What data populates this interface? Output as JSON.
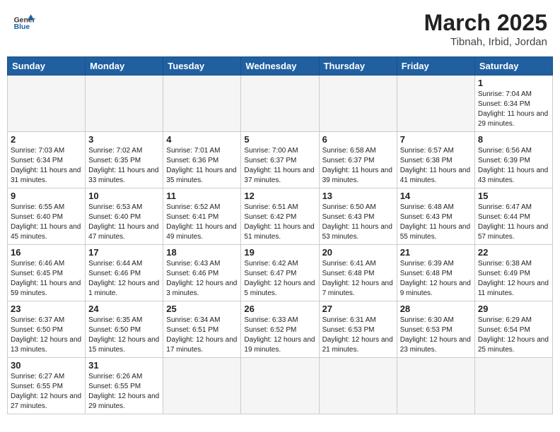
{
  "header": {
    "logo_general": "General",
    "logo_blue": "Blue",
    "month_title": "March 2025",
    "location": "Tibnah, Irbid, Jordan"
  },
  "days_of_week": [
    "Sunday",
    "Monday",
    "Tuesday",
    "Wednesday",
    "Thursday",
    "Friday",
    "Saturday"
  ],
  "weeks": [
    [
      {
        "day": "",
        "info": ""
      },
      {
        "day": "",
        "info": ""
      },
      {
        "day": "",
        "info": ""
      },
      {
        "day": "",
        "info": ""
      },
      {
        "day": "",
        "info": ""
      },
      {
        "day": "",
        "info": ""
      },
      {
        "day": "1",
        "info": "Sunrise: 7:04 AM\nSunset: 6:34 PM\nDaylight: 11 hours and 29 minutes."
      }
    ],
    [
      {
        "day": "2",
        "info": "Sunrise: 7:03 AM\nSunset: 6:34 PM\nDaylight: 11 hours and 31 minutes."
      },
      {
        "day": "3",
        "info": "Sunrise: 7:02 AM\nSunset: 6:35 PM\nDaylight: 11 hours and 33 minutes."
      },
      {
        "day": "4",
        "info": "Sunrise: 7:01 AM\nSunset: 6:36 PM\nDaylight: 11 hours and 35 minutes."
      },
      {
        "day": "5",
        "info": "Sunrise: 7:00 AM\nSunset: 6:37 PM\nDaylight: 11 hours and 37 minutes."
      },
      {
        "day": "6",
        "info": "Sunrise: 6:58 AM\nSunset: 6:37 PM\nDaylight: 11 hours and 39 minutes."
      },
      {
        "day": "7",
        "info": "Sunrise: 6:57 AM\nSunset: 6:38 PM\nDaylight: 11 hours and 41 minutes."
      },
      {
        "day": "8",
        "info": "Sunrise: 6:56 AM\nSunset: 6:39 PM\nDaylight: 11 hours and 43 minutes."
      }
    ],
    [
      {
        "day": "9",
        "info": "Sunrise: 6:55 AM\nSunset: 6:40 PM\nDaylight: 11 hours and 45 minutes."
      },
      {
        "day": "10",
        "info": "Sunrise: 6:53 AM\nSunset: 6:40 PM\nDaylight: 11 hours and 47 minutes."
      },
      {
        "day": "11",
        "info": "Sunrise: 6:52 AM\nSunset: 6:41 PM\nDaylight: 11 hours and 49 minutes."
      },
      {
        "day": "12",
        "info": "Sunrise: 6:51 AM\nSunset: 6:42 PM\nDaylight: 11 hours and 51 minutes."
      },
      {
        "day": "13",
        "info": "Sunrise: 6:50 AM\nSunset: 6:43 PM\nDaylight: 11 hours and 53 minutes."
      },
      {
        "day": "14",
        "info": "Sunrise: 6:48 AM\nSunset: 6:43 PM\nDaylight: 11 hours and 55 minutes."
      },
      {
        "day": "15",
        "info": "Sunrise: 6:47 AM\nSunset: 6:44 PM\nDaylight: 11 hours and 57 minutes."
      }
    ],
    [
      {
        "day": "16",
        "info": "Sunrise: 6:46 AM\nSunset: 6:45 PM\nDaylight: 11 hours and 59 minutes."
      },
      {
        "day": "17",
        "info": "Sunrise: 6:44 AM\nSunset: 6:46 PM\nDaylight: 12 hours and 1 minute."
      },
      {
        "day": "18",
        "info": "Sunrise: 6:43 AM\nSunset: 6:46 PM\nDaylight: 12 hours and 3 minutes."
      },
      {
        "day": "19",
        "info": "Sunrise: 6:42 AM\nSunset: 6:47 PM\nDaylight: 12 hours and 5 minutes."
      },
      {
        "day": "20",
        "info": "Sunrise: 6:41 AM\nSunset: 6:48 PM\nDaylight: 12 hours and 7 minutes."
      },
      {
        "day": "21",
        "info": "Sunrise: 6:39 AM\nSunset: 6:48 PM\nDaylight: 12 hours and 9 minutes."
      },
      {
        "day": "22",
        "info": "Sunrise: 6:38 AM\nSunset: 6:49 PM\nDaylight: 12 hours and 11 minutes."
      }
    ],
    [
      {
        "day": "23",
        "info": "Sunrise: 6:37 AM\nSunset: 6:50 PM\nDaylight: 12 hours and 13 minutes."
      },
      {
        "day": "24",
        "info": "Sunrise: 6:35 AM\nSunset: 6:50 PM\nDaylight: 12 hours and 15 minutes."
      },
      {
        "day": "25",
        "info": "Sunrise: 6:34 AM\nSunset: 6:51 PM\nDaylight: 12 hours and 17 minutes."
      },
      {
        "day": "26",
        "info": "Sunrise: 6:33 AM\nSunset: 6:52 PM\nDaylight: 12 hours and 19 minutes."
      },
      {
        "day": "27",
        "info": "Sunrise: 6:31 AM\nSunset: 6:53 PM\nDaylight: 12 hours and 21 minutes."
      },
      {
        "day": "28",
        "info": "Sunrise: 6:30 AM\nSunset: 6:53 PM\nDaylight: 12 hours and 23 minutes."
      },
      {
        "day": "29",
        "info": "Sunrise: 6:29 AM\nSunset: 6:54 PM\nDaylight: 12 hours and 25 minutes."
      }
    ],
    [
      {
        "day": "30",
        "info": "Sunrise: 6:27 AM\nSunset: 6:55 PM\nDaylight: 12 hours and 27 minutes."
      },
      {
        "day": "31",
        "info": "Sunrise: 6:26 AM\nSunset: 6:55 PM\nDaylight: 12 hours and 29 minutes."
      },
      {
        "day": "",
        "info": ""
      },
      {
        "day": "",
        "info": ""
      },
      {
        "day": "",
        "info": ""
      },
      {
        "day": "",
        "info": ""
      },
      {
        "day": "",
        "info": ""
      }
    ]
  ]
}
